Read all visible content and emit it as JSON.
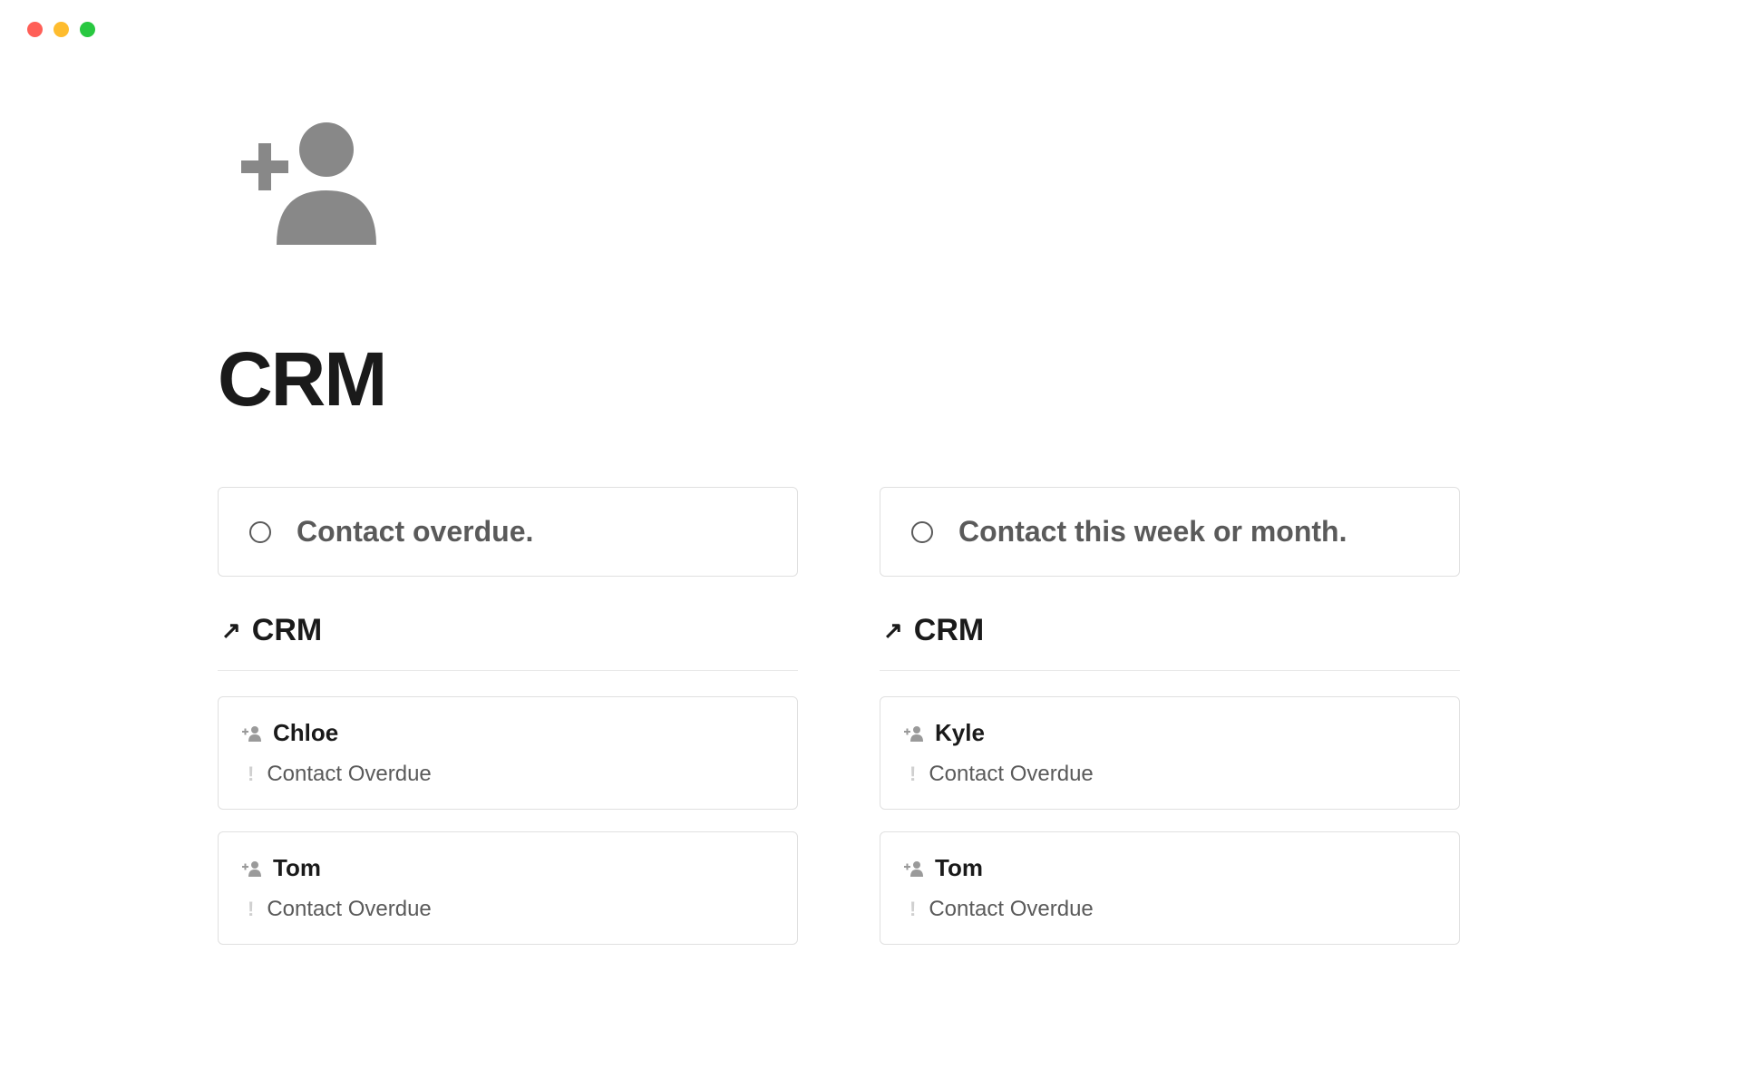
{
  "page": {
    "title": "CRM"
  },
  "columns": [
    {
      "header": "Contact overdue.",
      "link_label": "CRM",
      "contacts": [
        {
          "name": "Chloe",
          "status": "Contact Overdue"
        },
        {
          "name": "Tom",
          "status": "Contact Overdue"
        }
      ]
    },
    {
      "header": "Contact this week or month.",
      "link_label": "CRM",
      "contacts": [
        {
          "name": "Kyle",
          "status": "Contact Overdue"
        },
        {
          "name": "Tom",
          "status": "Contact Overdue"
        }
      ]
    }
  ]
}
